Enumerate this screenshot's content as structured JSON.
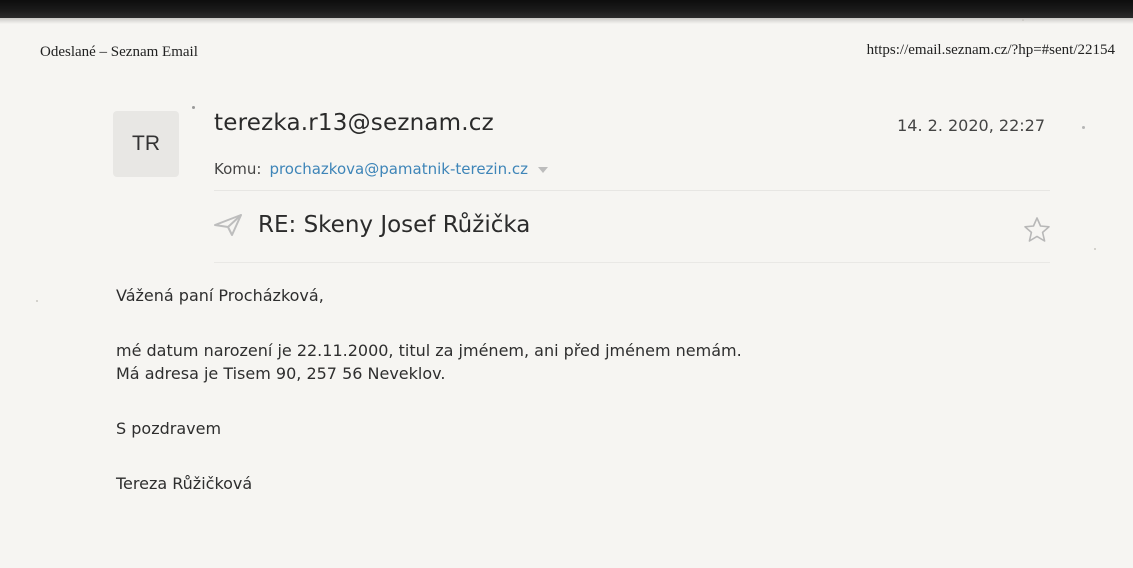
{
  "print_header": {
    "title": "Odeslané – Seznam Email",
    "url": "https://email.seznam.cz/?hp=#sent/22154"
  },
  "message": {
    "avatar_initials": "TR",
    "sender": "terezka.r13@seznam.cz",
    "date": "14. 2. 2020, 22:27",
    "to_label": "Komu:",
    "to_address": "prochazkova@pamatnik-terezin.cz",
    "subject": "RE: Skeny Josef Růžička",
    "body": {
      "greeting": "Vážená paní Procházková,",
      "line1": "mé datum narození je 22.11.2000, titul za jménem, ani před jménem nemám.",
      "line2": "Má adresa je Tisem 90, 257 56 Neveklov.",
      "closing": "S pozdravem",
      "signature": "Tereza Růžičková"
    }
  },
  "icons": {
    "sent": "paper-plane-icon",
    "star": "star-outline-icon",
    "dropdown": "chevron-down-icon"
  },
  "colors": {
    "link": "#3e85b8",
    "text": "#2a2a2a",
    "muted_icon": "#bcbcbc"
  }
}
